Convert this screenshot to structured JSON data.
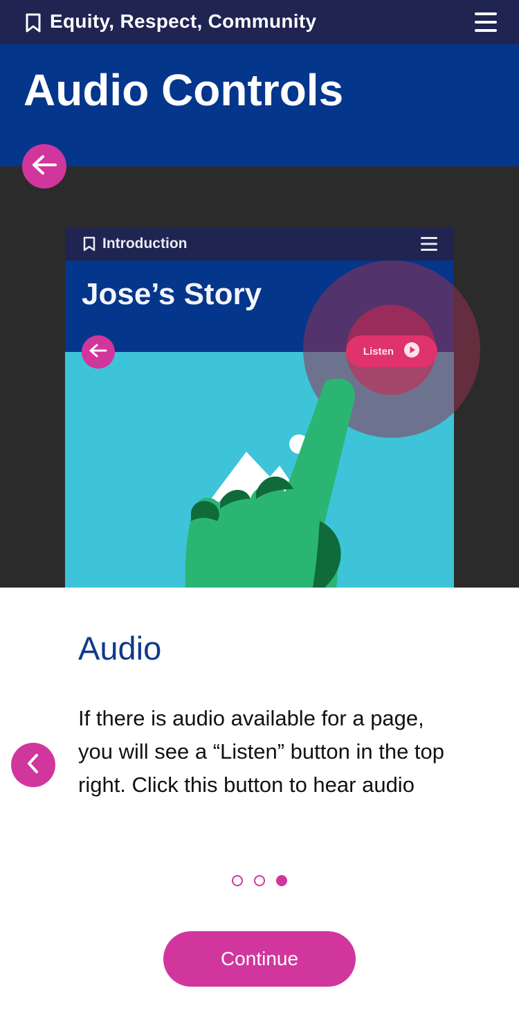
{
  "header": {
    "section_title": "Equity, Respect, Community",
    "bookmark_icon": "bookmark-icon",
    "menu_icon": "hamburger-menu-icon"
  },
  "page": {
    "title": "Audio Controls",
    "back_icon": "arrow-left-icon"
  },
  "illustration": {
    "chapter_label": "Introduction",
    "story_title": "Jose’s Story",
    "listen_label": "Listen",
    "listen_icon": "play-circle-icon"
  },
  "card": {
    "heading": "Audio",
    "body": "If there is audio available for a page, you will see a “Listen” button in the top right. Click this button to hear audio",
    "prev_icon": "chevron-left-icon"
  },
  "pagination": {
    "total": 3,
    "active": 3
  },
  "actions": {
    "continue_label": "Continue"
  },
  "colors": {
    "topbar": "#1f2451",
    "header_blue": "#04368c",
    "accent_magenta": "#d1369d",
    "dark_bg": "#2b2b2b",
    "illustration_cyan": "#3dc4d9",
    "heading_blue": "#0d3a8c"
  }
}
